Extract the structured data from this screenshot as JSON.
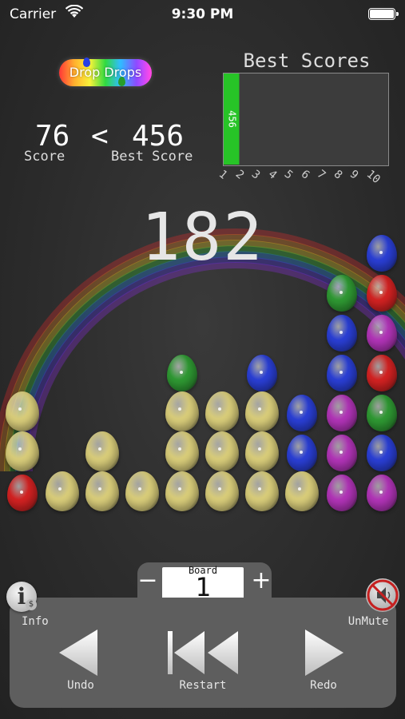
{
  "status_bar": {
    "carrier": "Carrier",
    "time": "9:30 PM"
  },
  "logo": {
    "text": "Drop Drops"
  },
  "score": {
    "current": "76",
    "comparator": "<",
    "best": "456",
    "score_label": "Score",
    "best_label": "Best Score"
  },
  "best_scores": {
    "title": "Best Scores",
    "chart_data": {
      "type": "bar",
      "categories": [
        "1",
        "2",
        "3",
        "4",
        "5",
        "6",
        "7",
        "8",
        "9",
        "10"
      ],
      "values": [
        456
      ],
      "bar_labels": [
        "456"
      ],
      "bar_color": "#27c427"
    }
  },
  "moves_counter": "182",
  "egg_colors": {
    "yellow": "#d9cd7a",
    "red": "#d42222",
    "blue": "#2a3fd6",
    "green": "#2f9a33",
    "magenta": "#b234b8"
  },
  "board": {
    "columns": [
      [
        "yellow",
        "yellow",
        "red"
      ],
      [
        "yellow"
      ],
      [
        "yellow",
        "yellow"
      ],
      [
        "yellow"
      ],
      [
        "green",
        "yellow",
        "yellow",
        "yellow"
      ],
      [
        "yellow",
        "yellow",
        "yellow"
      ],
      [
        "blue",
        "yellow",
        "yellow",
        "yellow"
      ],
      [
        "blue",
        "blue",
        "yellow"
      ],
      [
        "green",
        "blue",
        "blue",
        "magenta",
        "magenta",
        "magenta"
      ],
      [
        "blue",
        "red",
        "magenta",
        "red",
        "green",
        "blue",
        "magenta"
      ]
    ]
  },
  "board_selector": {
    "label": "Board",
    "value": "1",
    "minus": "−",
    "plus": "+"
  },
  "controls": {
    "info": "Info",
    "unmute": "UnMute",
    "undo": "Undo",
    "restart": "Restart",
    "redo": "Redo"
  },
  "info_icon": {
    "glyph": "i",
    "badge": "$"
  }
}
